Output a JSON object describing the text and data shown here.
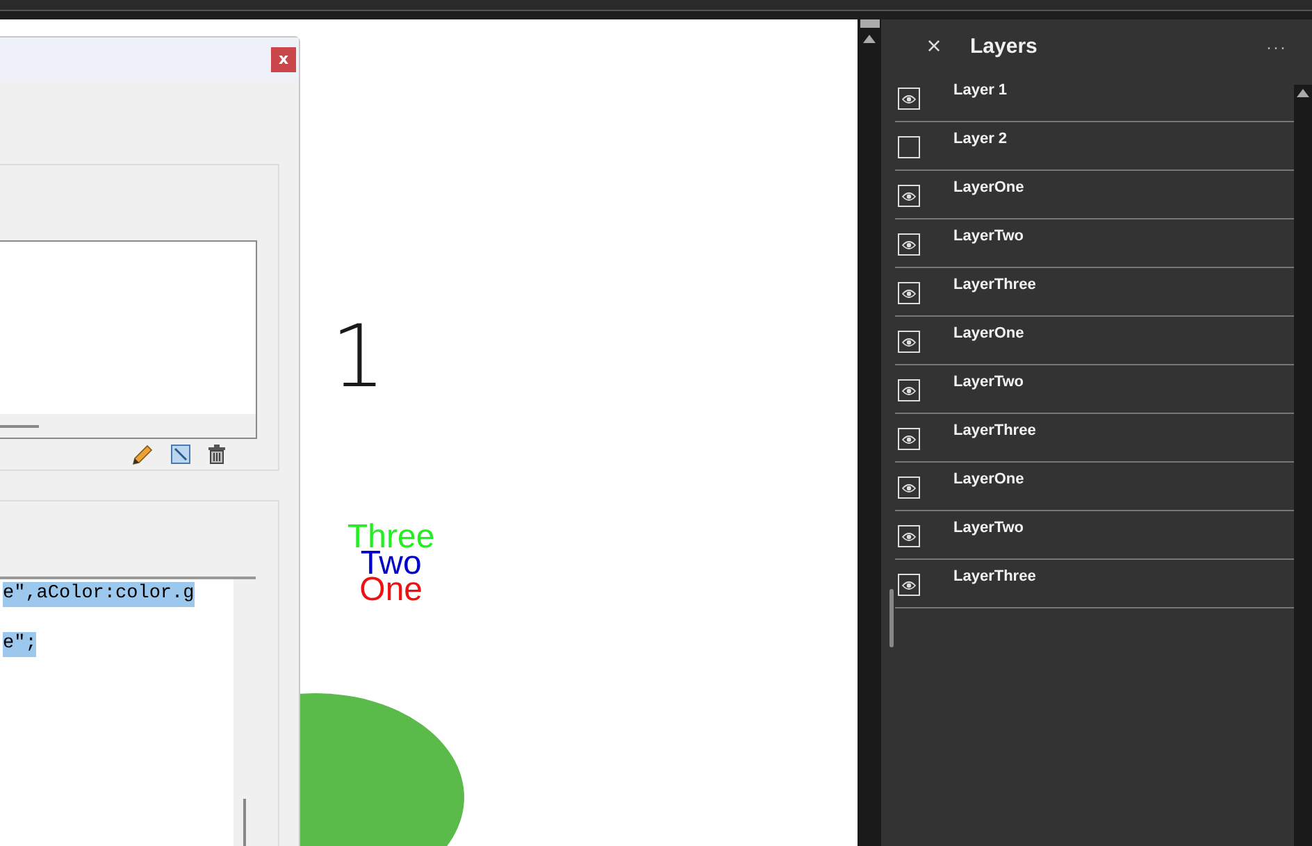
{
  "canvas": {
    "heading": "1",
    "stack_texts": [
      {
        "text": "Three",
        "color": "#22ee22"
      },
      {
        "text": "Two",
        "color": "#0000cc"
      },
      {
        "text": "One",
        "color": "#ee1111"
      }
    ]
  },
  "dialog": {
    "close_label": "x",
    "code_lines": [
      {
        "text": "e\",aColor:color.g",
        "selected": true
      },
      {
        "text": "e\";",
        "selected": true
      }
    ]
  },
  "layers_panel": {
    "title": "Layers",
    "close_label": "×",
    "more_label": "···",
    "layers": [
      {
        "name": "Layer 1",
        "visible": true
      },
      {
        "name": "Layer 2",
        "visible": false
      },
      {
        "name": "LayerOne",
        "visible": true
      },
      {
        "name": "LayerTwo",
        "visible": true
      },
      {
        "name": "LayerThree",
        "visible": true
      },
      {
        "name": "LayerOne",
        "visible": true
      },
      {
        "name": "LayerTwo",
        "visible": true
      },
      {
        "name": "LayerThree",
        "visible": true
      },
      {
        "name": "LayerOne",
        "visible": true
      },
      {
        "name": "LayerTwo",
        "visible": true
      },
      {
        "name": "LayerThree",
        "visible": true
      }
    ]
  }
}
